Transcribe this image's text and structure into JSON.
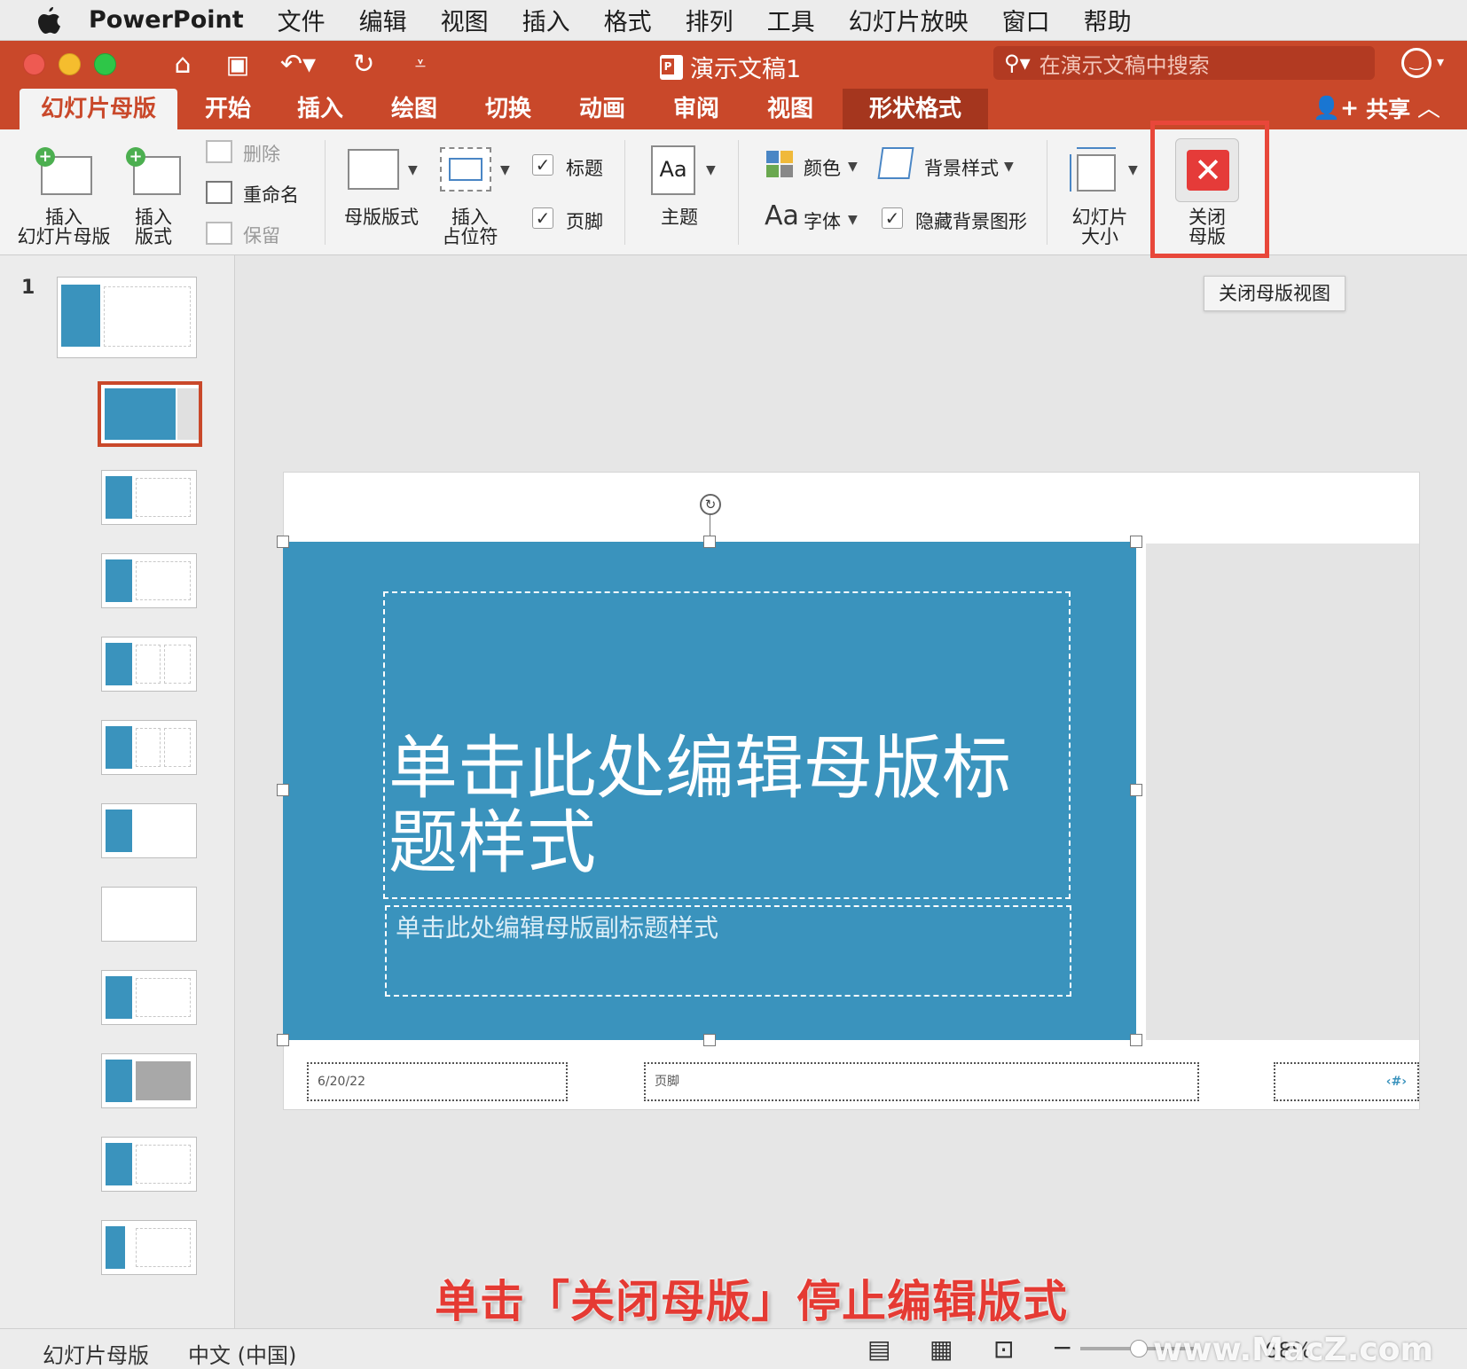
{
  "menubar": {
    "app_name": "PowerPoint",
    "items": [
      "文件",
      "编辑",
      "视图",
      "插入",
      "格式",
      "排列",
      "工具",
      "幻灯片放映",
      "窗口",
      "帮助"
    ]
  },
  "titlebar": {
    "document_title": "演示文稿1",
    "search_placeholder": "在演示文稿中搜索"
  },
  "tabs": [
    "幻灯片母版",
    "开始",
    "插入",
    "绘图",
    "切换",
    "动画",
    "审阅",
    "视图",
    "形状格式"
  ],
  "share_label": "共享",
  "ribbon": {
    "insert_master": "插入\n幻灯片母版",
    "insert_layout": "插入\n版式",
    "delete": "删除",
    "rename": "重命名",
    "preserve": "保留",
    "master_layout": "母版版式",
    "insert_placeholder": "插入\n占位符",
    "title_check": "标题",
    "footer_check": "页脚",
    "theme": "主题",
    "colors": "颜色",
    "fonts": "字体",
    "background_styles": "背景样式",
    "hide_bg_graphics": "隐藏背景图形",
    "slide_size": "幻灯片\n大小",
    "close_master": "关闭\n母版"
  },
  "tooltip": "关闭母版视图",
  "slide_panel": {
    "slide_number": "1",
    "thumb_count": 12
  },
  "slide": {
    "title": "单击此处编辑母版标题样式",
    "subtitle": "单击此处编辑母版副标题样式",
    "date": "6/20/22",
    "footer": "页脚",
    "slide_num": "‹#›"
  },
  "caption": "单击「关闭母版」停止编辑版式",
  "statusbar": {
    "view": "幻灯片母版",
    "language": "中文 (中国)",
    "zoom": "68%"
  },
  "watermark": "www.MacZ.com",
  "colors": {
    "accent": "#c9482a",
    "slide_blue": "#3a93bd",
    "highlight_red": "#e8473a"
  }
}
